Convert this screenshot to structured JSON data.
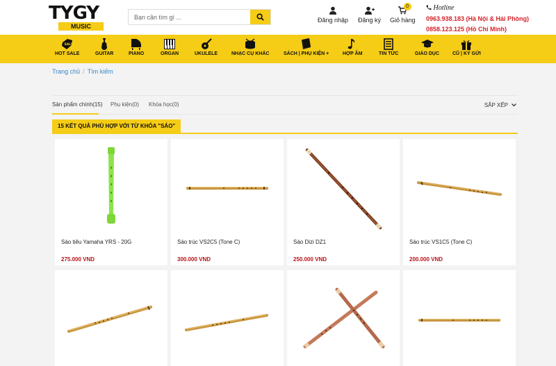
{
  "header": {
    "logo_top": "TYGY",
    "logo_bottom": "MUSIC",
    "search_placeholder": "Bạn cần tìm gì ...",
    "login_label": "Đăng nhập",
    "register_label": "Đăng ký",
    "cart_label": "Giỏ hàng",
    "cart_count": "0",
    "hotline_title": "Hotline",
    "hotline_north": "0963.938.183 (Hà Nội & Hải Phòng)",
    "hotline_south": "0858.123.125 (Hồ Chí Minh)"
  },
  "nav": [
    {
      "label": "HOT SALE",
      "icon": "sale-tag-icon"
    },
    {
      "label": "GUITAR",
      "icon": "guitar-icon"
    },
    {
      "label": "PIANO",
      "icon": "piano-icon"
    },
    {
      "label": "ORGAN",
      "icon": "keyboard-icon"
    },
    {
      "label": "UKULELE",
      "icon": "ukulele-icon"
    },
    {
      "label": "NHẠC CỤ KHÁC",
      "icon": "drum-icon"
    },
    {
      "label": "SÁCH | PHỤ KIỆN +",
      "icon": "book-icon"
    },
    {
      "label": "HỢP ÂM",
      "icon": "music-note-icon"
    },
    {
      "label": "TIN TỨC",
      "icon": "news-icon"
    },
    {
      "label": "GIÁO DỤC",
      "icon": "graduation-cap-icon"
    },
    {
      "label": "CŨ | KÝ GỬI",
      "icon": "gift-box-icon"
    }
  ],
  "breadcrumb": {
    "home": "Trang chủ",
    "separator": "/",
    "current": "Tìm kiếm"
  },
  "tabs": [
    {
      "label": "Sản phẩm chính(15)"
    },
    {
      "label": "Phụ kiện(0)"
    },
    {
      "label": "Khóa học(0)"
    }
  ],
  "sort_label": "SẮP XẾP",
  "result_text": "15 KẾT QUẢ PHÙ HỢP VỚI TỪ KHÓA \"SÁO\"",
  "products": [
    {
      "name": "Sáo tiêu Yamaha YRS - 20G",
      "price": "275.000 VND",
      "image": "recorder-image"
    },
    {
      "name": "Sáo trúc VS2C5 (Tone C)",
      "price": "300.000 VND",
      "image": "bamboo-flute-image"
    },
    {
      "name": "Sáo Dizi DZ1",
      "price": "250.000 VND",
      "image": "dizi-flute-image"
    },
    {
      "name": "Sáo trúc VS1C5 (Tone C)",
      "price": "200.000 VND",
      "image": "bamboo-flute-image"
    },
    {
      "name": "",
      "price": "",
      "image": "bamboo-flute-image"
    },
    {
      "name": "",
      "price": "",
      "image": "bamboo-flute-image"
    },
    {
      "name": "",
      "price": "",
      "image": "crossed-flutes-image"
    },
    {
      "name": "",
      "price": "",
      "image": "bamboo-flute-image"
    }
  ],
  "colors": {
    "accent": "#f5cc16",
    "price": "#b5131a",
    "hotline": "#d4232a",
    "link": "#3a87c8"
  }
}
